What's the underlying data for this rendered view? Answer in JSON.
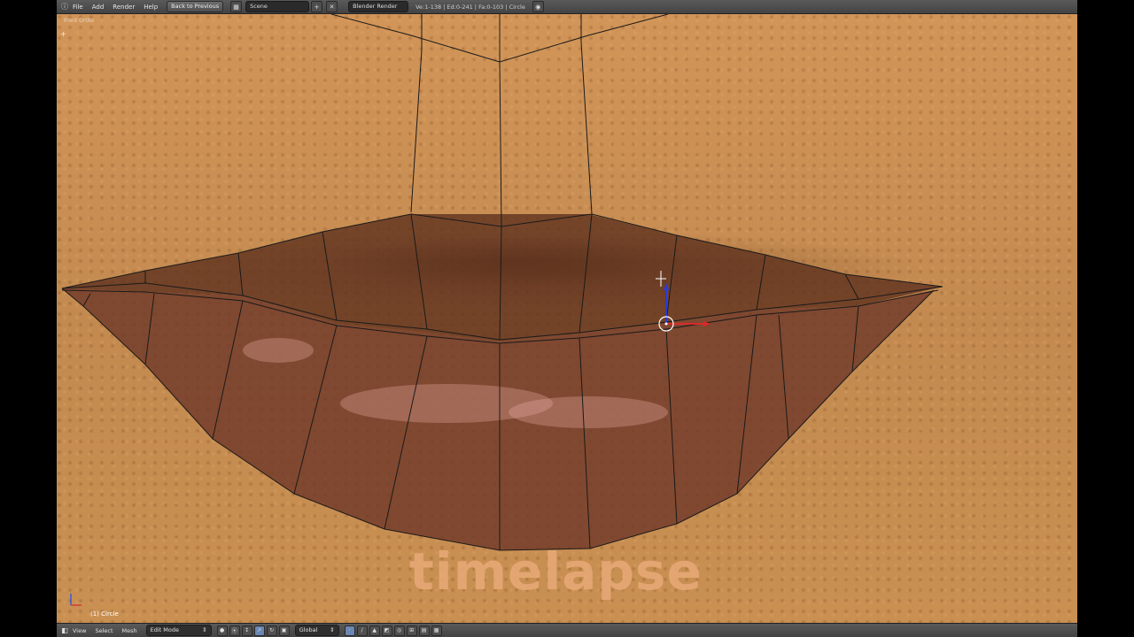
{
  "header": {
    "menus": [
      "File",
      "Add",
      "Render",
      "Help"
    ],
    "back_button": "Back to Previous",
    "scene_field": "Scene",
    "render_engine": "Blender Render",
    "stats": "Ve:1-138 | Ed:0-241 | Fa:0-103 | Circle"
  },
  "viewport": {
    "view_label": "Front Ortho",
    "object_label": "(1) Circle",
    "overlay_text": "timelapse"
  },
  "footer": {
    "menus": [
      "View",
      "Select",
      "Mesh"
    ],
    "mode": "Edit Mode",
    "orientation": "Global"
  },
  "colors": {
    "ui_bg": "#434343",
    "skin": "#c48a4e",
    "overlay_text": "#e8aa78",
    "wire": "#1a1a1a"
  }
}
